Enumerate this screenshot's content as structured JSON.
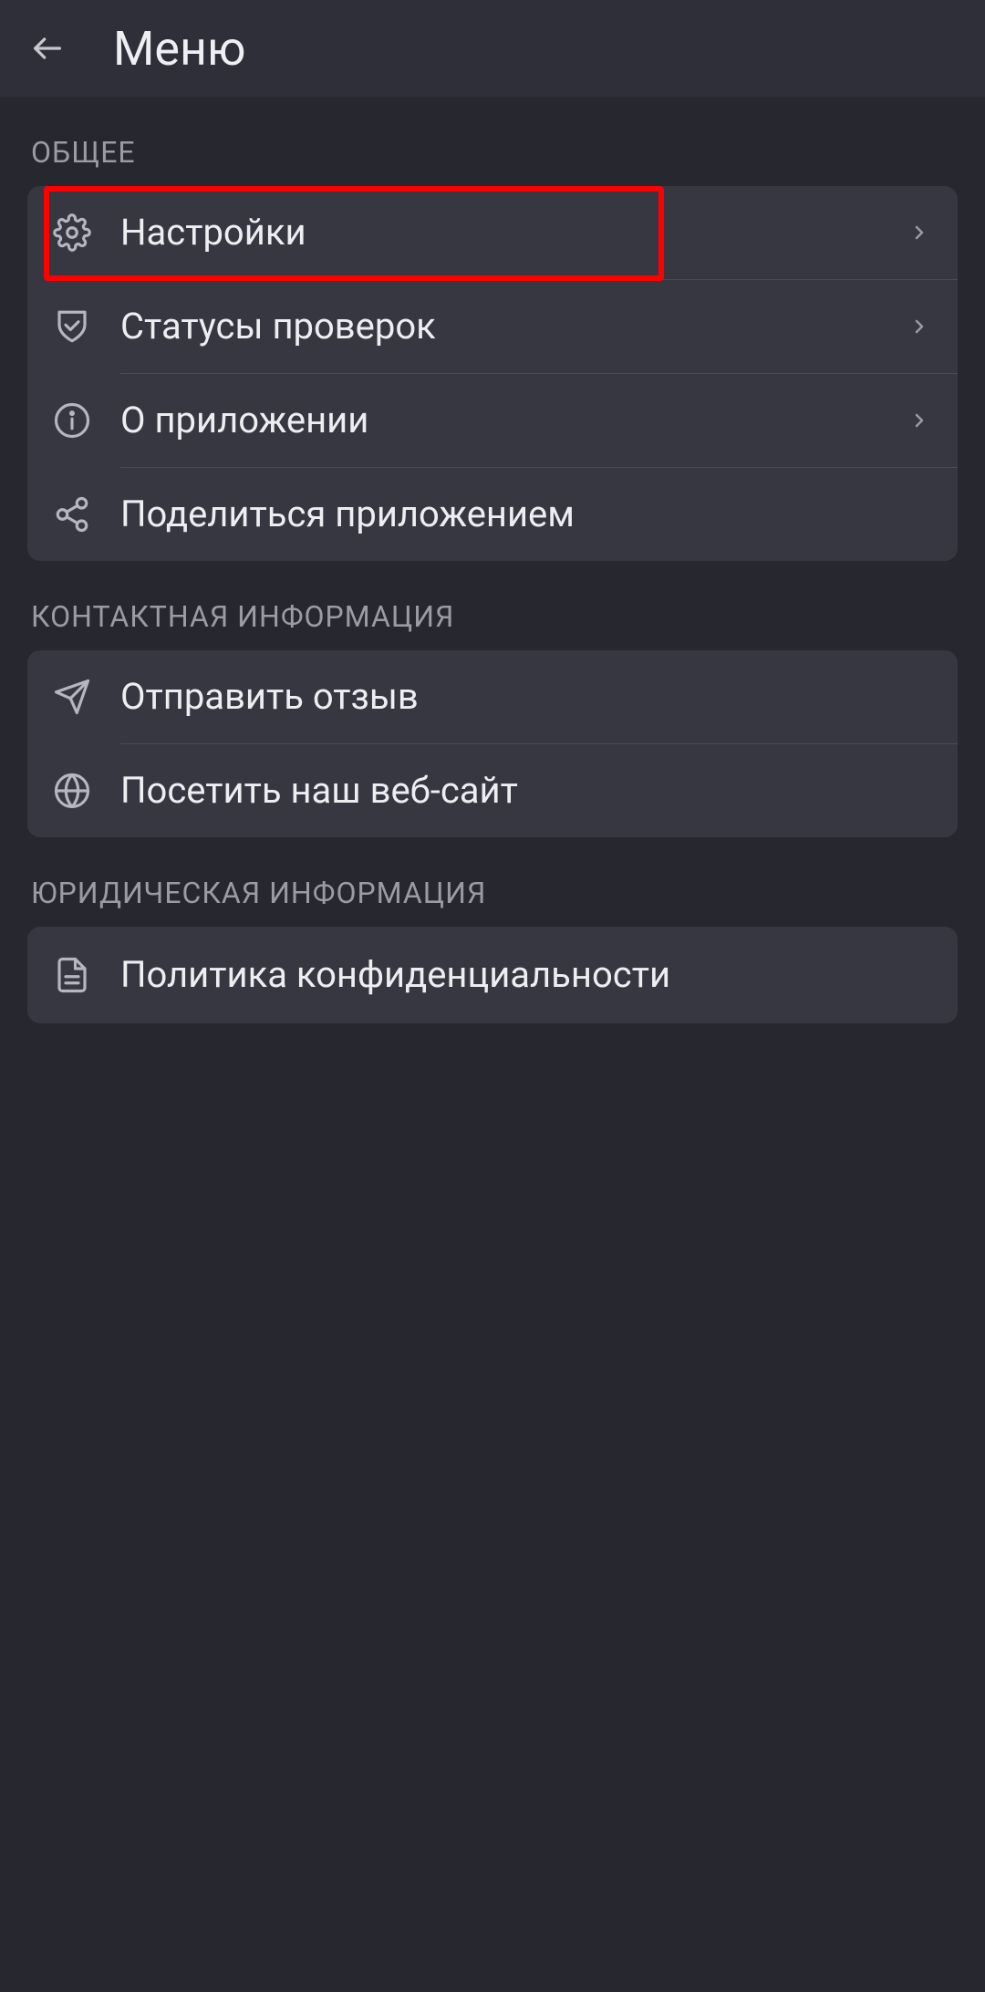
{
  "header": {
    "title": "Меню"
  },
  "sections": {
    "general": {
      "title": "ОБЩЕЕ",
      "items": {
        "settings": "Настройки",
        "check_statuses": "Статусы проверок",
        "about": "О приложении",
        "share": "Поделиться приложением"
      }
    },
    "contact": {
      "title": "КОНТАКТНАЯ ИНФОРМАЦИЯ",
      "items": {
        "feedback": "Отправить отзыв",
        "website": "Посетить наш веб-сайт"
      }
    },
    "legal": {
      "title": "ЮРИДИЧЕСКАЯ ИНФОРМАЦИЯ",
      "items": {
        "privacy": "Политика конфиденциальности"
      }
    }
  },
  "highlight": {
    "target": "settings"
  }
}
